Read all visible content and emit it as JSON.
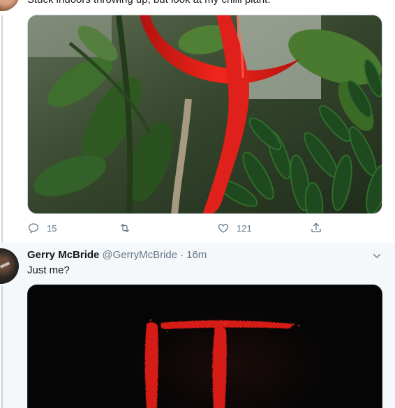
{
  "tweet1": {
    "text": "Stuck indoors throwing up, but look at my chilli plant.",
    "image_alt": "chilli-plant-photo",
    "replies": "15",
    "retweets": "",
    "likes": "121"
  },
  "tweet2": {
    "display_name": "Gerry McBride",
    "handle": "@GerryMcBride",
    "separator": "·",
    "time": "16m",
    "text": "Just me?",
    "image_alt": "it-movie-poster"
  },
  "colors": {
    "text": "#14171a",
    "secondary": "#657786",
    "border": "#ccd6dd",
    "chilli_red": "#e0201b",
    "poster_red": "#d61f12"
  },
  "icons": [
    "reply-icon",
    "retweet-icon",
    "like-icon",
    "share-icon",
    "chevron-down-icon"
  ]
}
